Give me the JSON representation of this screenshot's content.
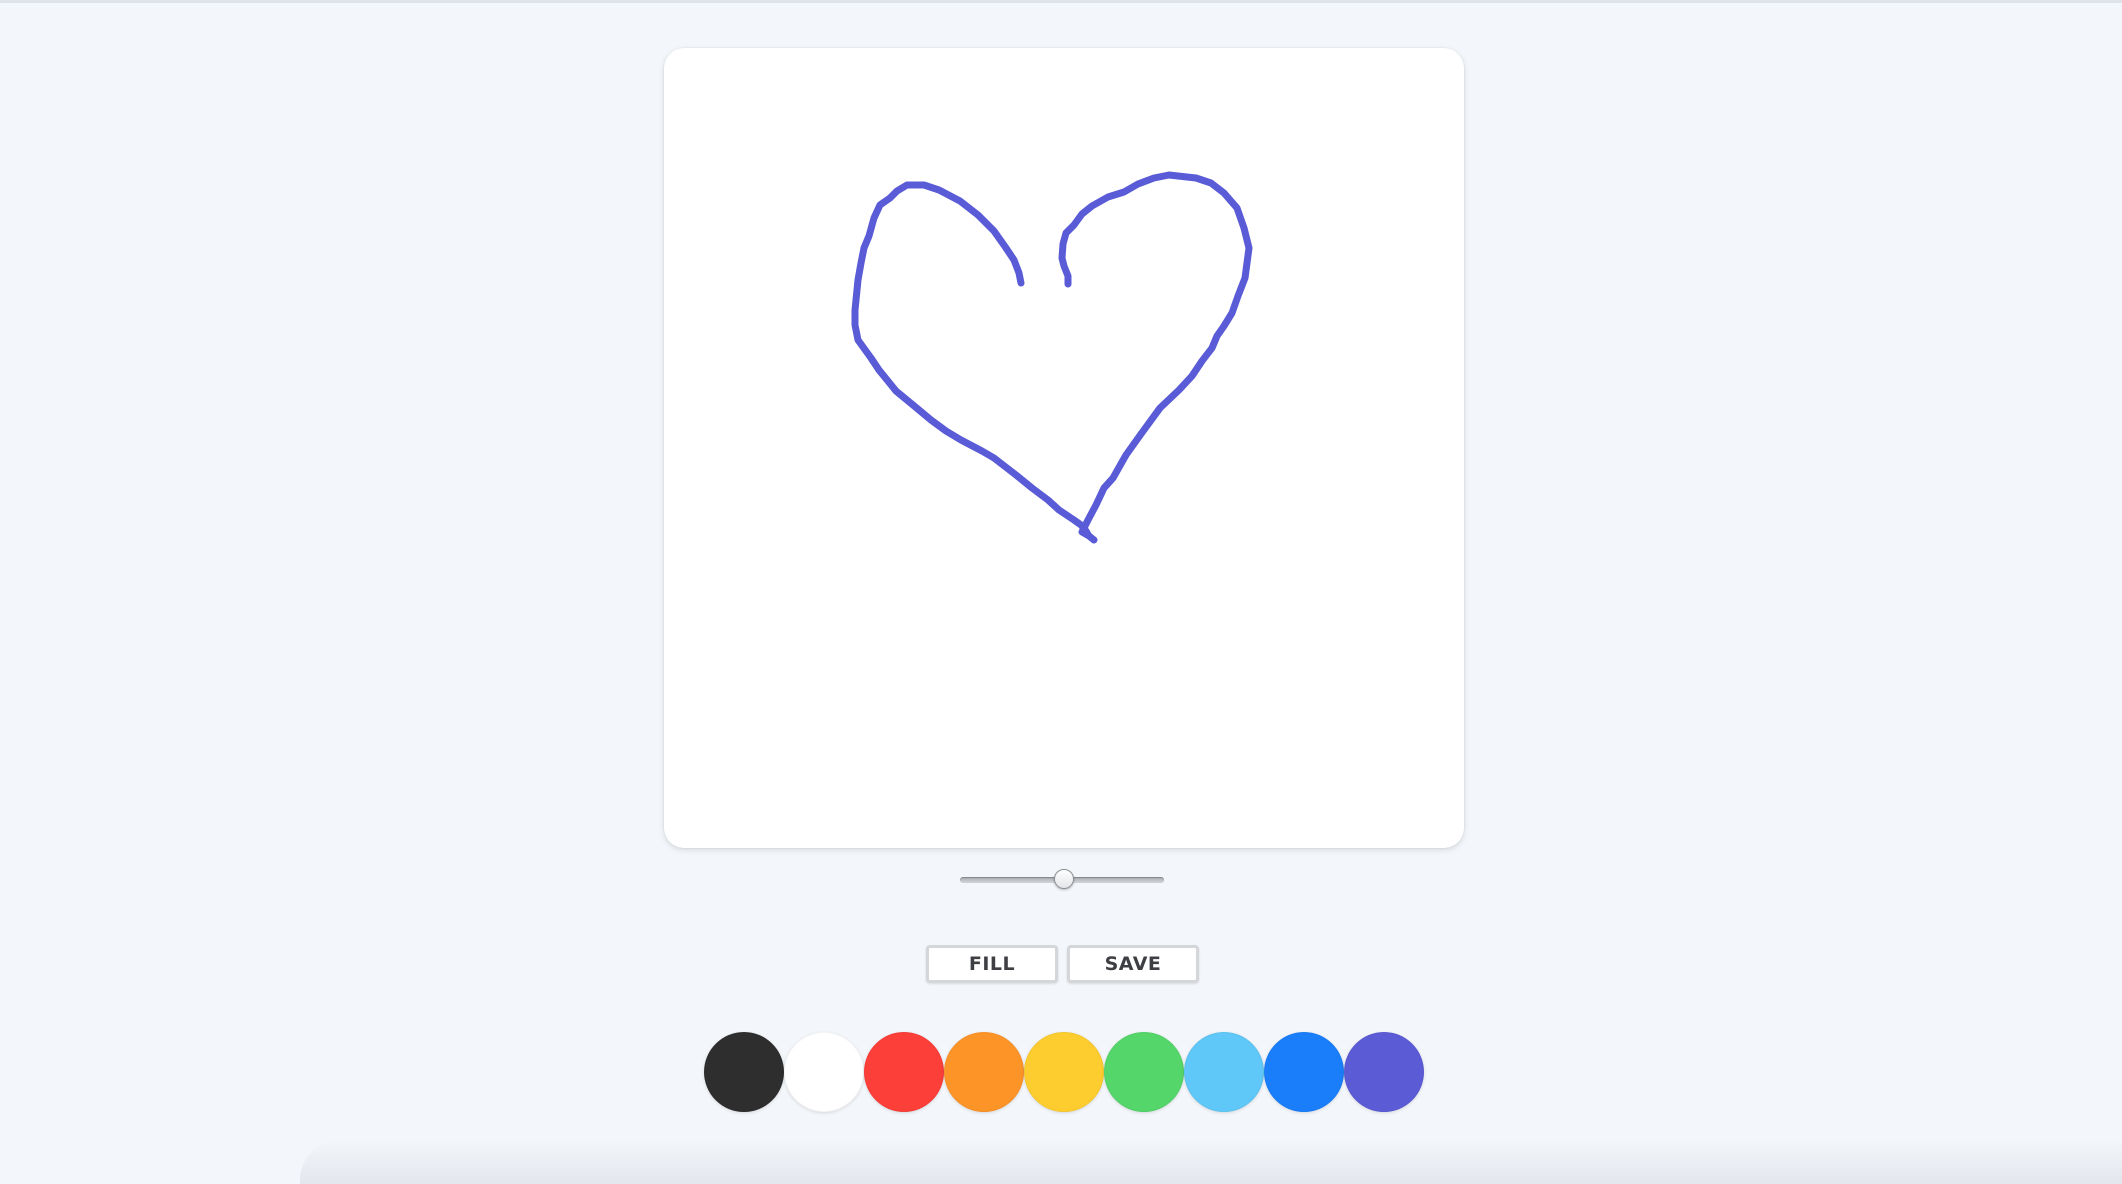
{
  "toolbar": {
    "fill_label": "FILL",
    "save_label": "SAVE"
  },
  "brush_size": {
    "value_fraction": 0.5
  },
  "stroke": {
    "color": "#5a5bd6",
    "shape": "heart"
  },
  "palette": {
    "colors": [
      {
        "name": "black",
        "hex": "#2e2e2e"
      },
      {
        "name": "white",
        "hex": "#ffffff"
      },
      {
        "name": "red",
        "hex": "#fc3f38"
      },
      {
        "name": "orange",
        "hex": "#fd9428"
      },
      {
        "name": "yellow",
        "hex": "#fdcc2f"
      },
      {
        "name": "green",
        "hex": "#54d66a"
      },
      {
        "name": "light-blue",
        "hex": "#60c8f8"
      },
      {
        "name": "blue",
        "hex": "#1a7efb"
      },
      {
        "name": "purple",
        "hex": "#5b5bd6"
      }
    ]
  }
}
